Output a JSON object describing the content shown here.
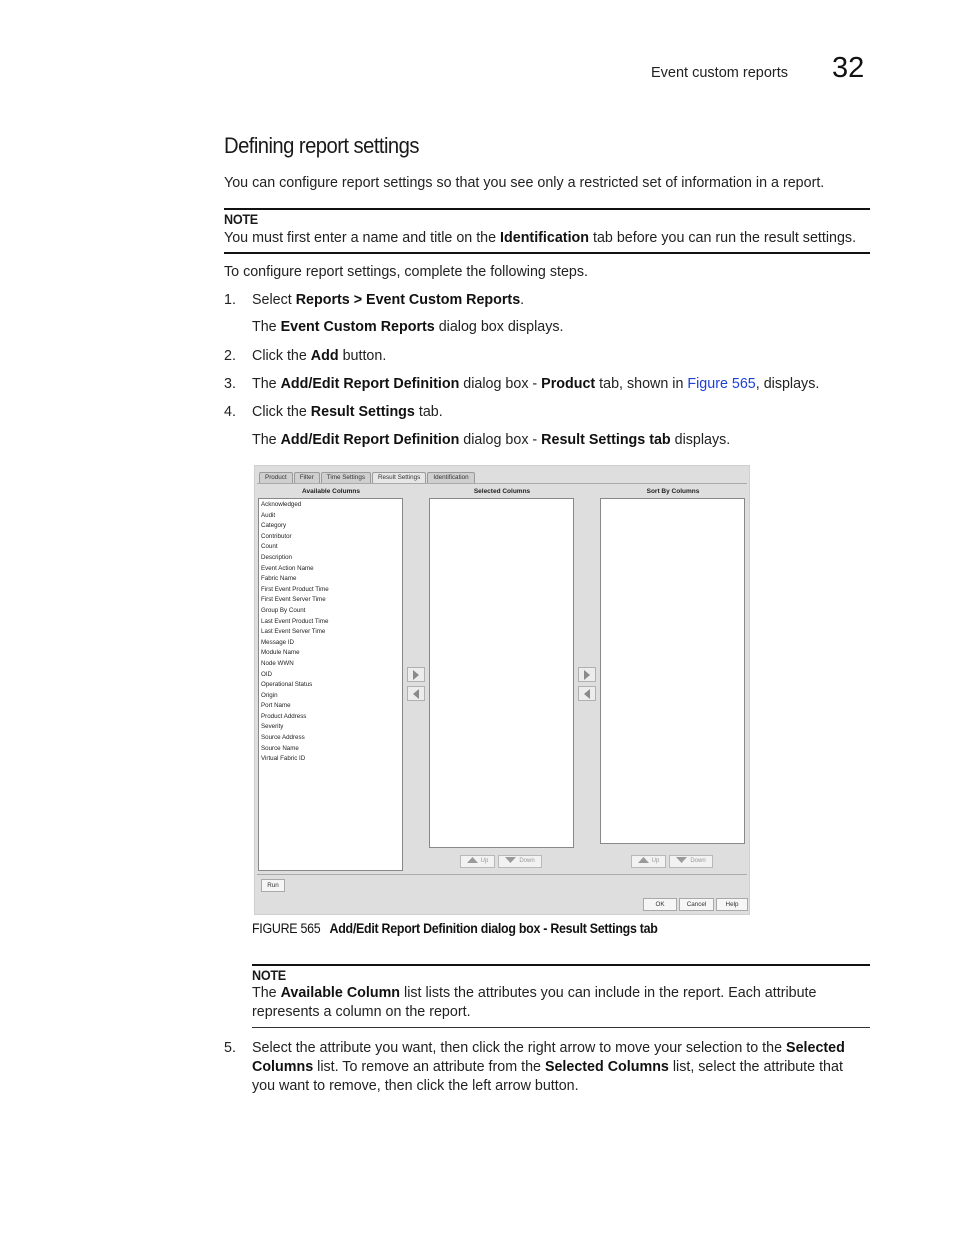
{
  "header": {
    "section_title": "Event custom reports",
    "chapter_number": "32"
  },
  "heading": "Defining report settings",
  "intro": "You can configure report settings so that you see only a restricted set of information in a report.",
  "note1": {
    "label": "NOTE",
    "text_pre": "You must first enter a name and title on the ",
    "text_bold": "Identification",
    "text_post": " tab before you can run the result settings."
  },
  "steps_intro": "To configure report settings, complete the following steps.",
  "steps": [
    {
      "num": "1.",
      "parts": [
        "Select ",
        "Reports > Event Custom Reports",
        "."
      ],
      "sub": [
        "The ",
        "Event Custom Reports",
        " dialog box displays."
      ]
    },
    {
      "num": "2.",
      "parts": [
        "Click the ",
        "Add",
        " button."
      ]
    },
    {
      "num": "3.",
      "parts": [
        "The ",
        "Add/Edit Report Definition",
        " dialog box - ",
        "Product",
        " tab, shown in ",
        "Figure 565",
        ", displays."
      ]
    },
    {
      "num": "4.",
      "parts": [
        "Click the ",
        "Result Settings",
        " tab."
      ],
      "sub": [
        "The ",
        "Add/Edit Report Definition",
        " dialog box - ",
        "Result Settings tab",
        " displays."
      ]
    },
    {
      "num": "5.",
      "lines": [
        [
          "Select the attribute you want, then click the right arrow to move your selection to the ",
          "Selected"
        ],
        [
          "Columns",
          " list. To remove an attribute from the ",
          "Selected Columns",
          " list, select the attribute that"
        ],
        [
          "you want to remove, then click the left arrow button."
        ]
      ]
    }
  ],
  "figure": {
    "number": "FIGURE 565",
    "title": "Add/Edit Report Definition dialog box - Result Settings tab"
  },
  "note2": {
    "label": "NOTE",
    "line1_pre": "The ",
    "line1_bold": "Available Column",
    "line1_post": " list lists the attributes you can include in the report. Each attribute",
    "line2": "represents a column on the report."
  },
  "dialog": {
    "tabs": [
      "Product",
      "Filter",
      "Time Settings",
      "Result Settings",
      "Identification"
    ],
    "active_tab": "Result Settings",
    "available_columns_title": "Available Columns",
    "selected_columns_title": "Selected Columns",
    "sort_by_columns_title": "Sort By Columns",
    "available_columns": [
      "Acknowledged",
      "Audit",
      "Category",
      "Contributor",
      "Count",
      "Description",
      "Event Action Name",
      "Fabric Name",
      "First Event Product Time",
      "First Event Server Time",
      "Group By Count",
      "Last Event Product Time",
      "Last Event Server Time",
      "Message ID",
      "Module Name",
      "Node WWN",
      "OID",
      "Operational Status",
      "Origin",
      "Port Name",
      "Product Address",
      "Severity",
      "Source Address",
      "Source Name",
      "Virtual Fabric ID"
    ],
    "selected_columns": [],
    "sort_by_columns": [],
    "up_label": "Up",
    "down_label": "Down",
    "run_label": "Run",
    "ok_label": "OK",
    "cancel_label": "Cancel",
    "help_label": "Help"
  }
}
